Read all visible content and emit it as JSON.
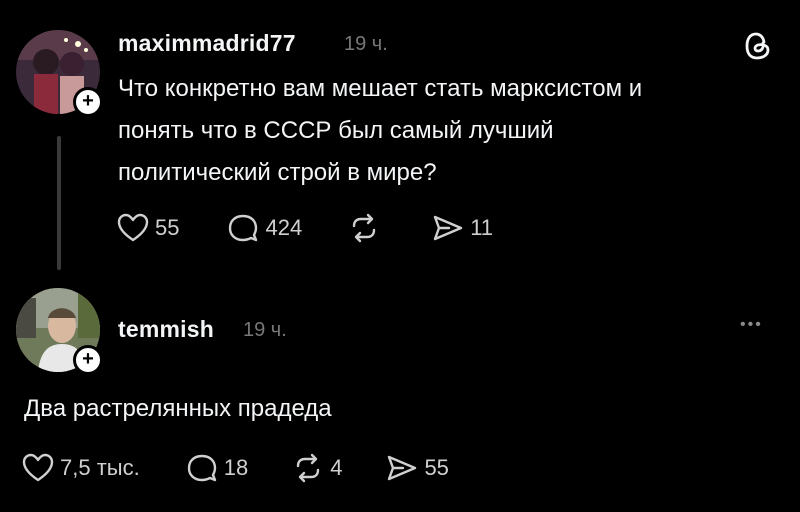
{
  "post1": {
    "username": "maximmadrid77",
    "time": "19 ч.",
    "text": "Что конкретно вам мешает стать марксистом и\nпонять что в СССР был самый лучший\nполитический строй в мире?",
    "likes": "55",
    "comments": "424",
    "reposts": "",
    "shares": "11"
  },
  "post2": {
    "username": "temmish",
    "time": "19 ч.",
    "text": "Два растрелянных прадеда",
    "likes": "7,5 тыс.",
    "comments": "18",
    "reposts": "4",
    "shares": "55"
  },
  "icons": {
    "threads_logo": "threads-logo-icon",
    "more": "more-horizontal-icon",
    "like": "heart-icon",
    "comment": "comment-bubble-icon",
    "repost": "repost-icon",
    "share": "send-icon",
    "follow": "plus-icon"
  },
  "more_glyph": "•••"
}
